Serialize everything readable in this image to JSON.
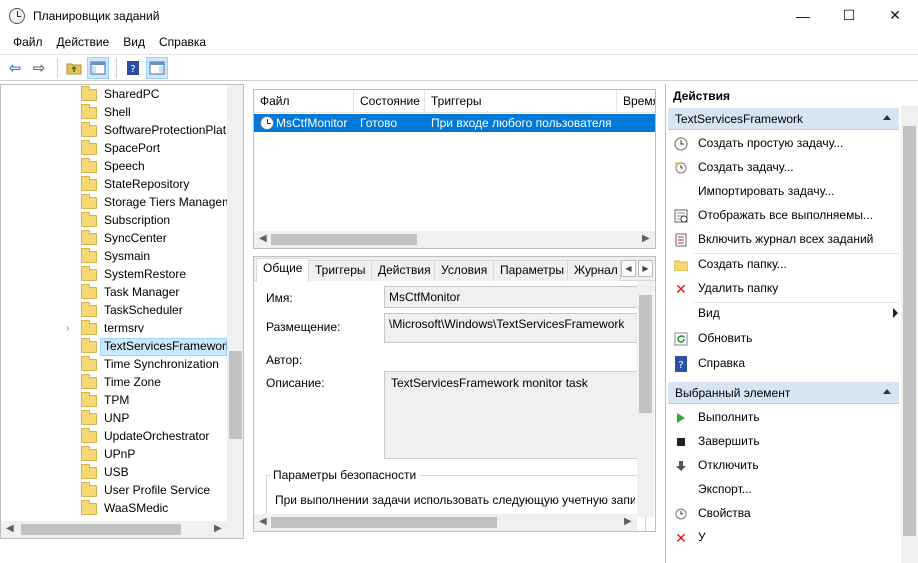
{
  "window": {
    "title": "Планировщик заданий",
    "minimize": "—",
    "maximize": "☐",
    "close": "✕"
  },
  "menu": [
    "Файл",
    "Действие",
    "Вид",
    "Справка"
  ],
  "tree": {
    "items": [
      {
        "label": "SharedPC"
      },
      {
        "label": "Shell"
      },
      {
        "label": "SoftwareProtectionPlat"
      },
      {
        "label": "SpacePort"
      },
      {
        "label": "Speech"
      },
      {
        "label": "StateRepository"
      },
      {
        "label": "Storage Tiers Managem"
      },
      {
        "label": "Subscription"
      },
      {
        "label": "SyncCenter"
      },
      {
        "label": "Sysmain"
      },
      {
        "label": "SystemRestore"
      },
      {
        "label": "Task Manager"
      },
      {
        "label": "TaskScheduler"
      },
      {
        "label": "termsrv",
        "expander": "›"
      },
      {
        "label": "TextServicesFramework",
        "selected": true
      },
      {
        "label": "Time Synchronization"
      },
      {
        "label": "Time Zone"
      },
      {
        "label": "TPM"
      },
      {
        "label": "UNP"
      },
      {
        "label": "UpdateOrchestrator"
      },
      {
        "label": "UPnP"
      },
      {
        "label": "USB"
      },
      {
        "label": "User Profile Service"
      },
      {
        "label": "WaaSMedic"
      }
    ]
  },
  "task_list": {
    "columns": [
      "Файл",
      "Состояние",
      "Триггеры",
      "Время"
    ],
    "rows": [
      {
        "name": "MsCtfMonitor",
        "state": "Готово",
        "trigger": "При входе любого пользователя",
        "time": ""
      }
    ]
  },
  "details": {
    "tabs": [
      "Общие",
      "Триггеры",
      "Действия",
      "Условия",
      "Параметры",
      "Журнал"
    ],
    "name_label": "Имя:",
    "name_value": "MsCtfMonitor",
    "location_label": "Размещение:",
    "location_value": "\\Microsoft\\Windows\\TextServicesFramework",
    "author_label": "Автор:",
    "description_label": "Описание:",
    "description_value": "TextServicesFramework monitor task",
    "security_group": "Параметры безопасности",
    "security_text": "При выполнении задачи использовать следующую учетную запи"
  },
  "actions": {
    "title": "Действия",
    "section1": "TextServicesFramework",
    "section1_items": [
      "Создать простую задачу...",
      "Создать задачу...",
      "Импортировать задачу...",
      "Отображать все выполняемы...",
      "Включить журнал всех заданий",
      "Создать папку...",
      "Удалить папку",
      "Вид",
      "Обновить",
      "Справка"
    ],
    "section2": "Выбранный элемент",
    "section2_items": [
      "Выполнить",
      "Завершить",
      "Отключить",
      "Экспорт...",
      "Свойства",
      "У"
    ]
  }
}
